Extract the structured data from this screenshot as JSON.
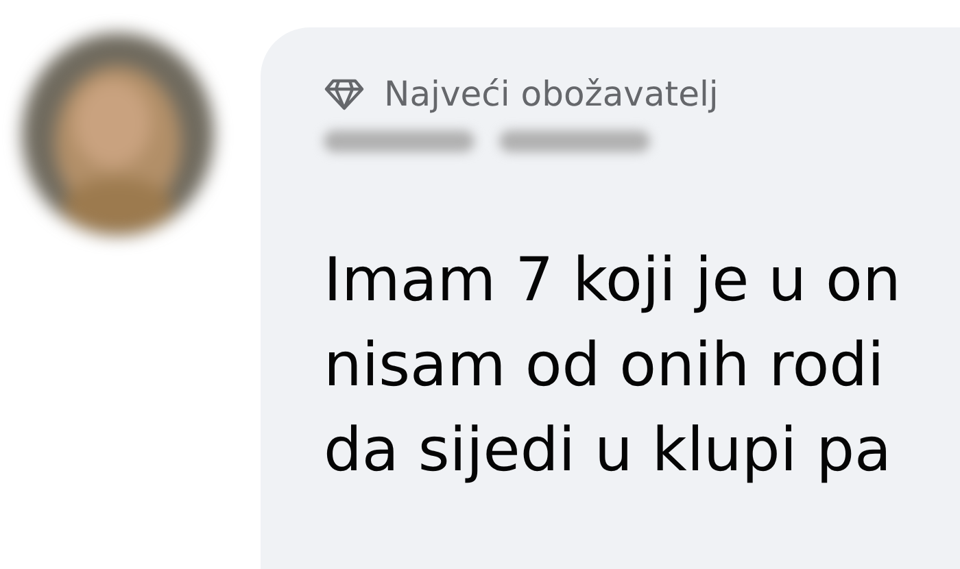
{
  "comment": {
    "badge": "Najveći obožavatelj",
    "author_blurred": true,
    "lines": [
      "Imam 7 koji je u on",
      "nisam od onih rodi",
      "da sijedi u klupi pa"
    ]
  }
}
